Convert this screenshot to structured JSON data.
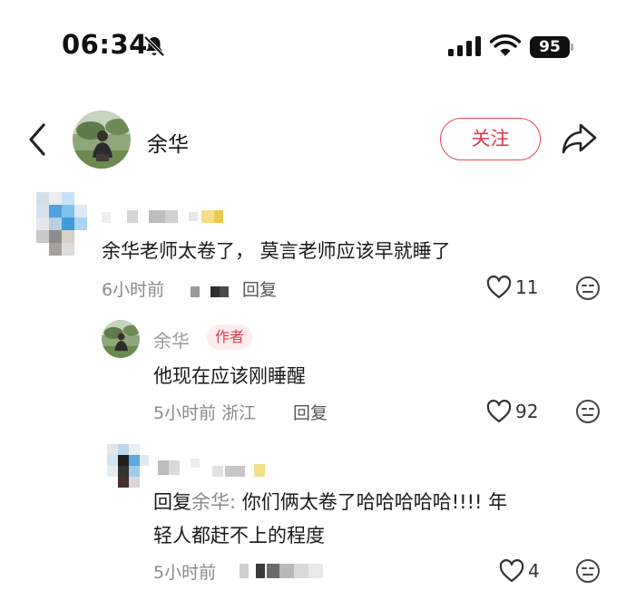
{
  "status_bar": {
    "time": "06:34",
    "battery": "95"
  },
  "header": {
    "author_name": "余华",
    "follow_label": "关注"
  },
  "comments": [
    {
      "text": "余华老师太卷了， 莫言老师应该早就睡了",
      "time": "6小时前",
      "reply_label": "回复",
      "like_count": "11"
    }
  ],
  "reply_1": {
    "username": "余华",
    "badge": "作者",
    "text": "他现在应该刚睡醒",
    "time": "5小时前 浙江",
    "reply_label": "回复",
    "like_count": "92"
  },
  "reply_2": {
    "prefix": "回复",
    "reply_to": "余华:",
    "text_line1": " 你们俩太卷了哈哈哈哈哈!!!!  年",
    "text_line2": "轻人都赶不上的程度",
    "time": "5小时前",
    "like_count": "4"
  },
  "colors": {
    "accent": "#e03a4c",
    "badge_bg": "#fdecee",
    "meta_text": "#8a8a8a"
  },
  "icons": [
    "bell-slash-icon",
    "signal-icon",
    "wifi-icon",
    "battery-icon",
    "back-arrow-icon",
    "share-arrow-icon",
    "heart-icon",
    "emoji-icon"
  ]
}
